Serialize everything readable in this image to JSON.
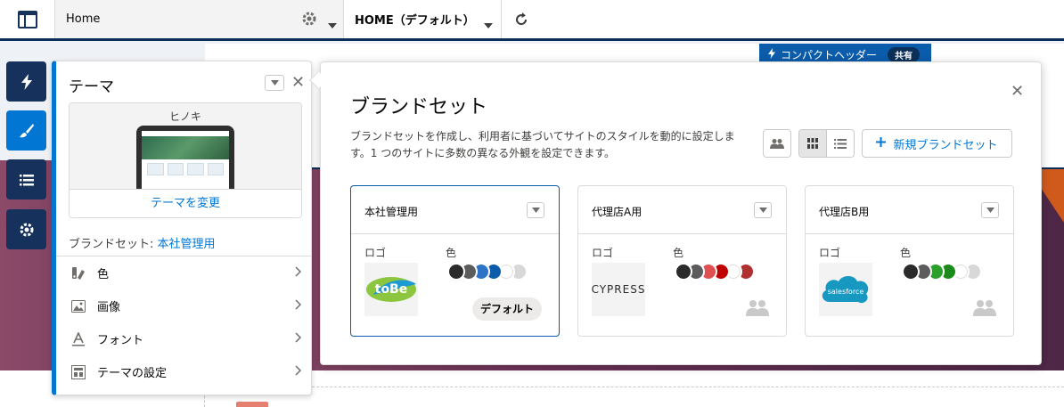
{
  "topbar": {
    "page_label": "Home",
    "variant_label": "HOME（デフォルト）",
    "icons": [
      "panel-layout-icon",
      "gear-icon",
      "chevron-down-icon",
      "refresh-icon"
    ]
  },
  "canvas": {
    "compact_header_label": "コンパクトヘッダー",
    "compact_header_badge": "共有"
  },
  "rail": {
    "items": [
      {
        "name": "lightning-icon",
        "active": false
      },
      {
        "name": "brush-icon",
        "active": true
      },
      {
        "name": "list-icon",
        "active": false
      },
      {
        "name": "gear-icon",
        "active": false
      }
    ]
  },
  "theme_panel": {
    "title": "テーマ",
    "theme_name": "ヒノキ",
    "change_theme": "テーマを変更",
    "brandset_prefix": "ブランドセット: ",
    "brandset_value": "本社管理用",
    "menu": [
      {
        "label": "色",
        "icon": "color-icon"
      },
      {
        "label": "画像",
        "icon": "image-icon"
      },
      {
        "label": "フォント",
        "icon": "font-icon"
      },
      {
        "label": "テーマの設定",
        "icon": "layout-icon"
      }
    ]
  },
  "modal": {
    "title": "ブランドセット",
    "description": "ブランドセットを作成し、利用者に基づいてサイトのスタイルを動的に設定します。1 つのサイトに多数の異なる外観を設定できます。",
    "new_button": "新規ブランドセット",
    "cards": [
      {
        "name": "本社管理用",
        "logo_label": "ロゴ",
        "color_label": "色",
        "logo_text": "toBe",
        "default_label": "デフォルト",
        "colors": [
          "#2b2b2b",
          "#5c5c5c",
          "#2b74c8",
          "#0b5cab",
          "#ffffff",
          "#d8d8d8"
        ]
      },
      {
        "name": "代理店A用",
        "logo_label": "ロゴ",
        "color_label": "色",
        "logo_text": "CYPRESS",
        "colors": [
          "#2b2b2b",
          "#5c5c5c",
          "#e05050",
          "#c00000",
          "#ffffff",
          "#b03030"
        ]
      },
      {
        "name": "代理店B用",
        "logo_label": "ロゴ",
        "color_label": "色",
        "logo_text": "salesforce",
        "colors": [
          "#2b2b2b",
          "#5c5c5c",
          "#2aa02a",
          "#1a8a1a",
          "#ffffff",
          "#d8d8d8"
        ]
      }
    ]
  }
}
